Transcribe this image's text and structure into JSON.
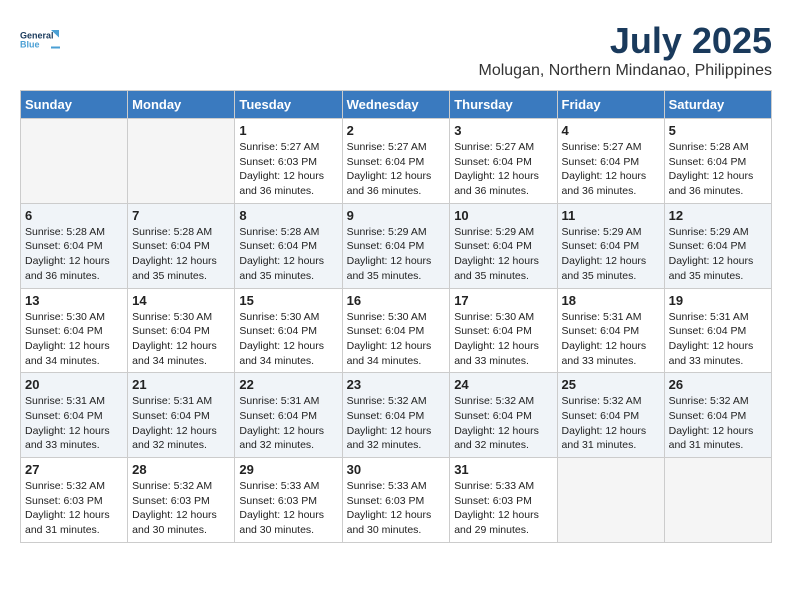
{
  "header": {
    "logo_general": "General",
    "logo_blue": "Blue",
    "month_year": "July 2025",
    "location": "Molugan, Northern Mindanao, Philippines"
  },
  "days_of_week": [
    "Sunday",
    "Monday",
    "Tuesday",
    "Wednesday",
    "Thursday",
    "Friday",
    "Saturday"
  ],
  "weeks": [
    [
      {
        "day": "",
        "empty": true
      },
      {
        "day": "",
        "empty": true
      },
      {
        "day": "1",
        "sunrise": "5:27 AM",
        "sunset": "6:03 PM",
        "daylight": "12 hours and 36 minutes."
      },
      {
        "day": "2",
        "sunrise": "5:27 AM",
        "sunset": "6:04 PM",
        "daylight": "12 hours and 36 minutes."
      },
      {
        "day": "3",
        "sunrise": "5:27 AM",
        "sunset": "6:04 PM",
        "daylight": "12 hours and 36 minutes."
      },
      {
        "day": "4",
        "sunrise": "5:27 AM",
        "sunset": "6:04 PM",
        "daylight": "12 hours and 36 minutes."
      },
      {
        "day": "5",
        "sunrise": "5:28 AM",
        "sunset": "6:04 PM",
        "daylight": "12 hours and 36 minutes."
      }
    ],
    [
      {
        "day": "6",
        "sunrise": "5:28 AM",
        "sunset": "6:04 PM",
        "daylight": "12 hours and 36 minutes."
      },
      {
        "day": "7",
        "sunrise": "5:28 AM",
        "sunset": "6:04 PM",
        "daylight": "12 hours and 35 minutes."
      },
      {
        "day": "8",
        "sunrise": "5:28 AM",
        "sunset": "6:04 PM",
        "daylight": "12 hours and 35 minutes."
      },
      {
        "day": "9",
        "sunrise": "5:29 AM",
        "sunset": "6:04 PM",
        "daylight": "12 hours and 35 minutes."
      },
      {
        "day": "10",
        "sunrise": "5:29 AM",
        "sunset": "6:04 PM",
        "daylight": "12 hours and 35 minutes."
      },
      {
        "day": "11",
        "sunrise": "5:29 AM",
        "sunset": "6:04 PM",
        "daylight": "12 hours and 35 minutes."
      },
      {
        "day": "12",
        "sunrise": "5:29 AM",
        "sunset": "6:04 PM",
        "daylight": "12 hours and 35 minutes."
      }
    ],
    [
      {
        "day": "13",
        "sunrise": "5:30 AM",
        "sunset": "6:04 PM",
        "daylight": "12 hours and 34 minutes."
      },
      {
        "day": "14",
        "sunrise": "5:30 AM",
        "sunset": "6:04 PM",
        "daylight": "12 hours and 34 minutes."
      },
      {
        "day": "15",
        "sunrise": "5:30 AM",
        "sunset": "6:04 PM",
        "daylight": "12 hours and 34 minutes."
      },
      {
        "day": "16",
        "sunrise": "5:30 AM",
        "sunset": "6:04 PM",
        "daylight": "12 hours and 34 minutes."
      },
      {
        "day": "17",
        "sunrise": "5:30 AM",
        "sunset": "6:04 PM",
        "daylight": "12 hours and 33 minutes."
      },
      {
        "day": "18",
        "sunrise": "5:31 AM",
        "sunset": "6:04 PM",
        "daylight": "12 hours and 33 minutes."
      },
      {
        "day": "19",
        "sunrise": "5:31 AM",
        "sunset": "6:04 PM",
        "daylight": "12 hours and 33 minutes."
      }
    ],
    [
      {
        "day": "20",
        "sunrise": "5:31 AM",
        "sunset": "6:04 PM",
        "daylight": "12 hours and 33 minutes."
      },
      {
        "day": "21",
        "sunrise": "5:31 AM",
        "sunset": "6:04 PM",
        "daylight": "12 hours and 32 minutes."
      },
      {
        "day": "22",
        "sunrise": "5:31 AM",
        "sunset": "6:04 PM",
        "daylight": "12 hours and 32 minutes."
      },
      {
        "day": "23",
        "sunrise": "5:32 AM",
        "sunset": "6:04 PM",
        "daylight": "12 hours and 32 minutes."
      },
      {
        "day": "24",
        "sunrise": "5:32 AM",
        "sunset": "6:04 PM",
        "daylight": "12 hours and 32 minutes."
      },
      {
        "day": "25",
        "sunrise": "5:32 AM",
        "sunset": "6:04 PM",
        "daylight": "12 hours and 31 minutes."
      },
      {
        "day": "26",
        "sunrise": "5:32 AM",
        "sunset": "6:04 PM",
        "daylight": "12 hours and 31 minutes."
      }
    ],
    [
      {
        "day": "27",
        "sunrise": "5:32 AM",
        "sunset": "6:03 PM",
        "daylight": "12 hours and 31 minutes."
      },
      {
        "day": "28",
        "sunrise": "5:32 AM",
        "sunset": "6:03 PM",
        "daylight": "12 hours and 30 minutes."
      },
      {
        "day": "29",
        "sunrise": "5:33 AM",
        "sunset": "6:03 PM",
        "daylight": "12 hours and 30 minutes."
      },
      {
        "day": "30",
        "sunrise": "5:33 AM",
        "sunset": "6:03 PM",
        "daylight": "12 hours and 30 minutes."
      },
      {
        "day": "31",
        "sunrise": "5:33 AM",
        "sunset": "6:03 PM",
        "daylight": "12 hours and 29 minutes."
      },
      {
        "day": "",
        "empty": true
      },
      {
        "day": "",
        "empty": true
      }
    ]
  ],
  "cell_labels": {
    "sunrise": "Sunrise:",
    "sunset": "Sunset:",
    "daylight": "Daylight:"
  }
}
